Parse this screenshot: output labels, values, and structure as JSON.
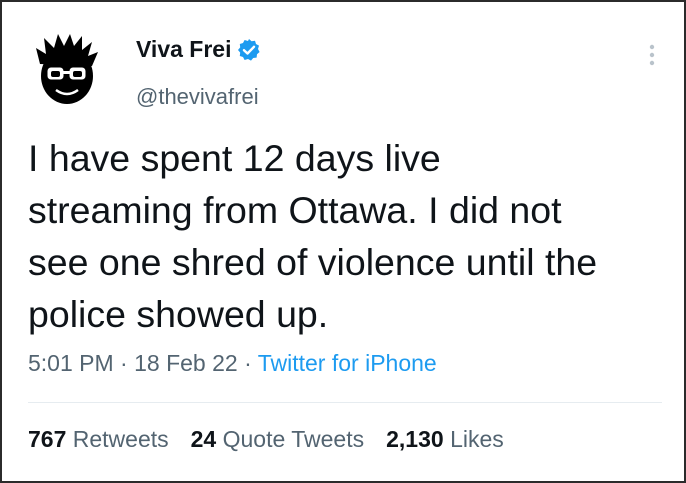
{
  "tweet": {
    "top_crop_text": "",
    "author": {
      "name": "Viva Frei",
      "handle": "@thevivafrei",
      "verified": true
    },
    "text": "I have spent 12 days live\nstreaming from Ottawa. I did not\nsee one shred of violence until the\npolice showed up.",
    "meta": {
      "time": "5:01 PM",
      "separator": " · ",
      "date": "18 Feb 22",
      "source": "Twitter for iPhone"
    },
    "stats": {
      "retweets_count": "767",
      "retweets_label": "Retweets",
      "quote_count": "24",
      "quote_label": "Quote Tweets",
      "likes_count": "2,130",
      "likes_label": "Likes"
    }
  },
  "colors": {
    "text": "#0f1419",
    "secondary": "#536471",
    "accent": "#1d9bf0"
  },
  "icons": {
    "avatar": "cartoon-face-with-glasses-avatar",
    "verified": "verified-badge-icon",
    "more": "more-options-icon"
  }
}
